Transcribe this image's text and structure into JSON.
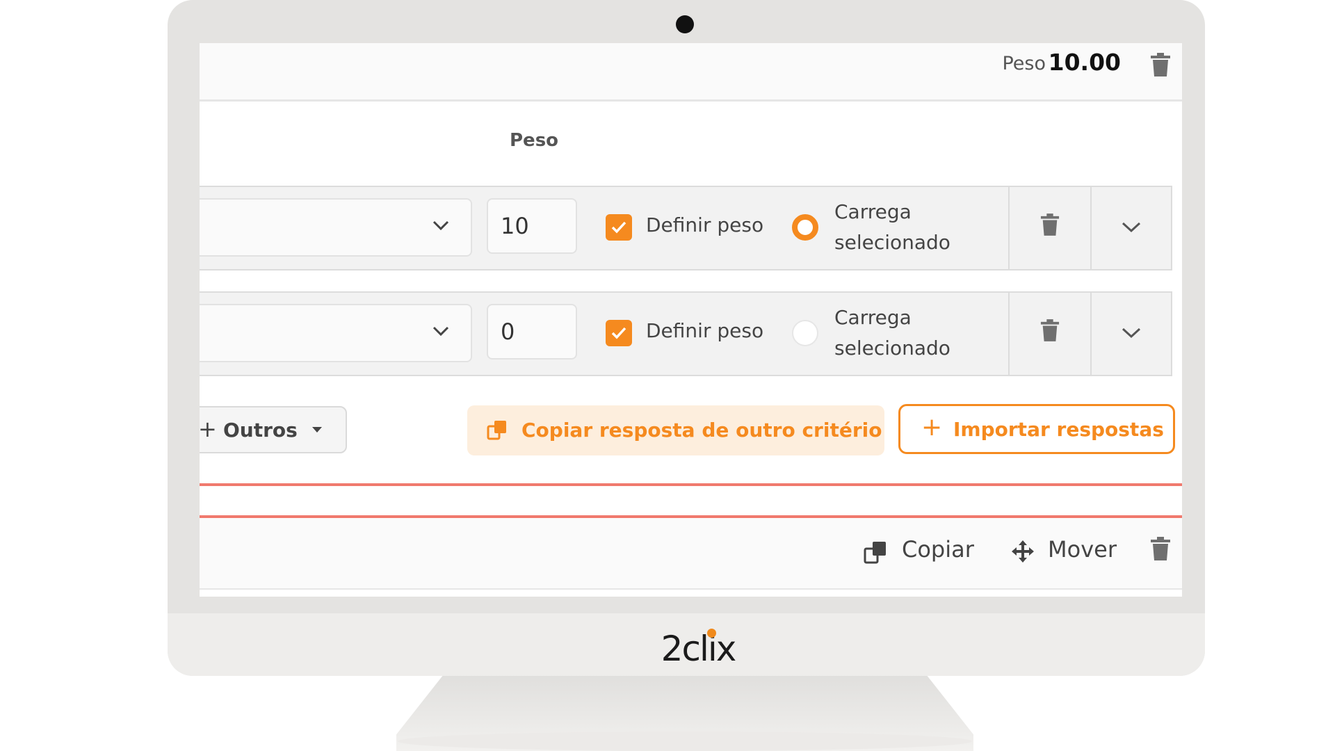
{
  "header": {
    "weight_label": "Peso",
    "weight_value": "10.00"
  },
  "table": {
    "weight_column_header": "Peso",
    "rows": [
      {
        "weight_value": "10",
        "define_weight_checked": true,
        "define_weight_label": "Definir peso",
        "loads_selected": true,
        "loads_selected_label_line1": "Carrega",
        "loads_selected_label_line2": "selecionado"
      },
      {
        "weight_value": "0",
        "define_weight_checked": true,
        "define_weight_label": "Definir peso",
        "loads_selected": false,
        "loads_selected_label_line1": "Carrega",
        "loads_selected_label_line2": "selecionado"
      }
    ]
  },
  "actions": {
    "others_label": "Outros",
    "copy_from_criterion_label": "Copiar resposta de outro critério",
    "import_answers_label": "Importar respostas"
  },
  "footer": {
    "copy_label": "Copiar",
    "move_label": "Mover"
  },
  "brand": {
    "logo_text": "2clix"
  },
  "colors": {
    "accent": "#f58a1f",
    "divider_red": "#f07a6e"
  }
}
